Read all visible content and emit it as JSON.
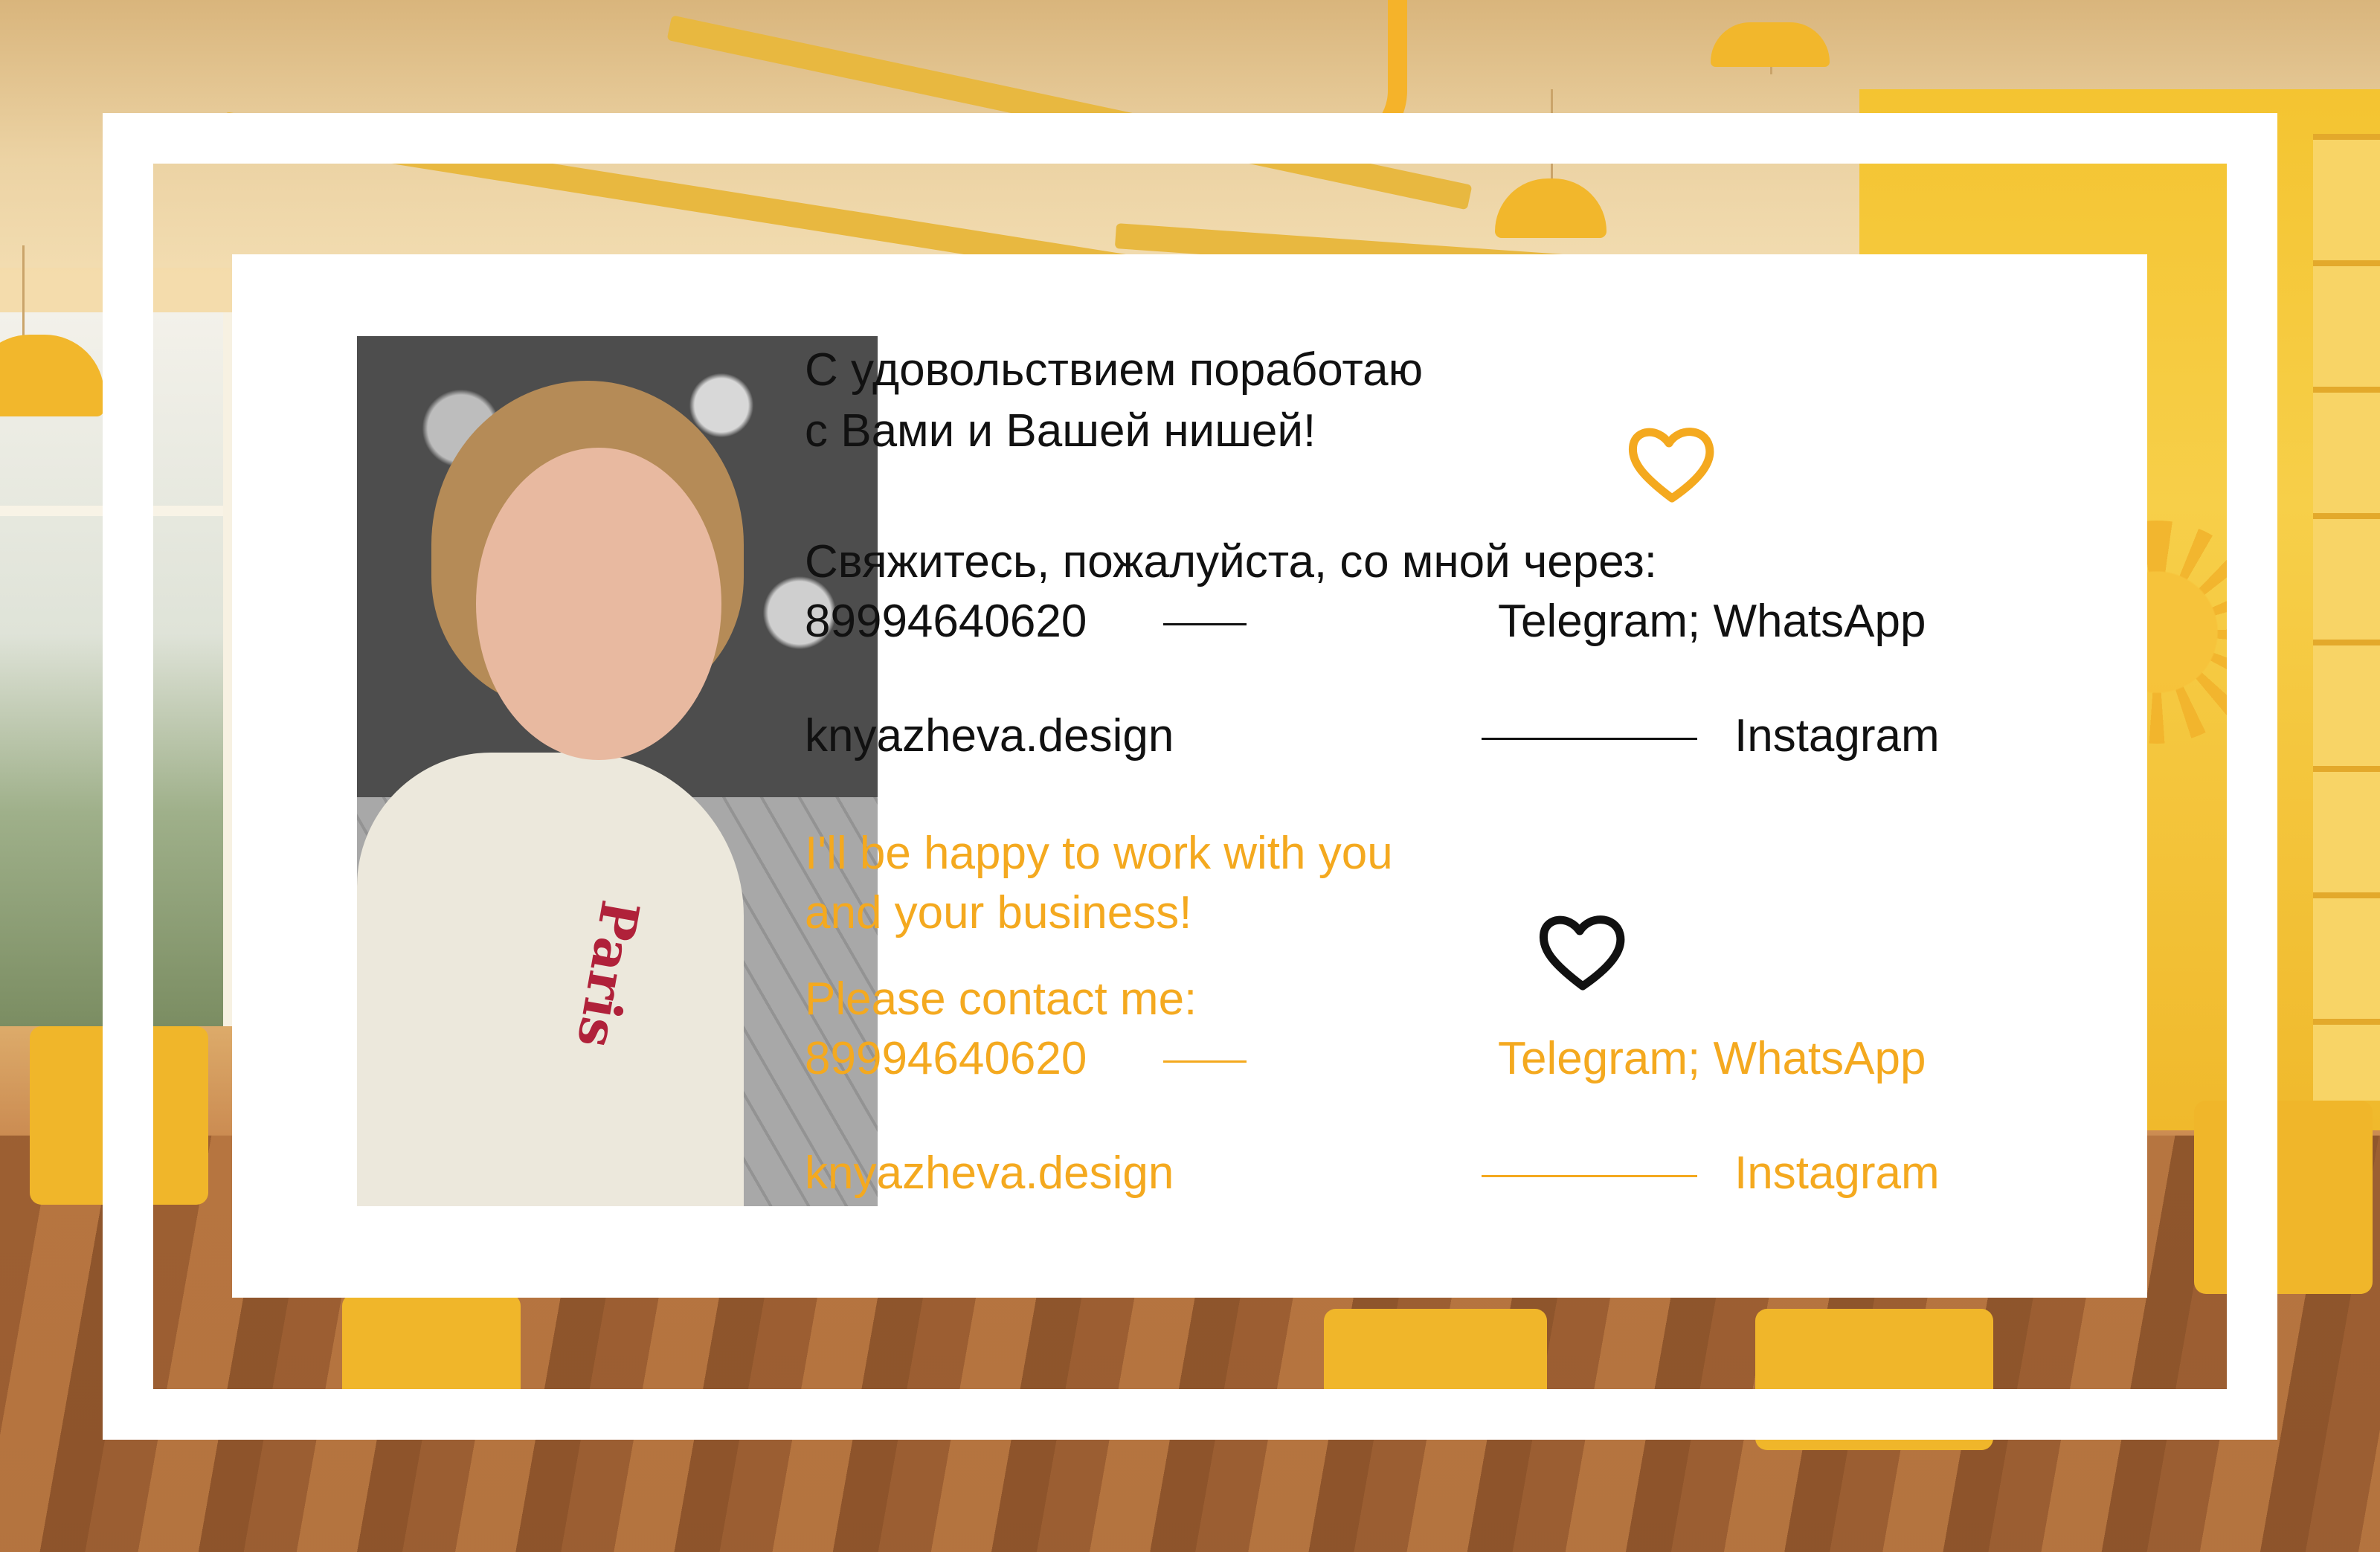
{
  "colors": {
    "accent": "#f4a91f",
    "text": "#111111",
    "card": "#ffffff"
  },
  "russian": {
    "intro_line1": "С удовольствием поработаю",
    "intro_line2": "с Вами и Вашей нишей!",
    "contact_line": "Свяжитесь, пожалуйста, со мной через:",
    "phone": "89994640620",
    "messengers": "Telegram; WhatsApp",
    "site": "knyazheva.design",
    "social": "Instagram"
  },
  "english": {
    "intro_line1": "I'll be happy to work with you",
    "intro_line2": "and your business!",
    "contact_line": "Please contact me:",
    "phone": "89994640620",
    "messengers": "Telegram; WhatsApp",
    "site": "knyazheva.design",
    "social": "Instagram"
  },
  "icons": [
    "heart-outline-orange-icon",
    "heart-outline-black-icon"
  ]
}
